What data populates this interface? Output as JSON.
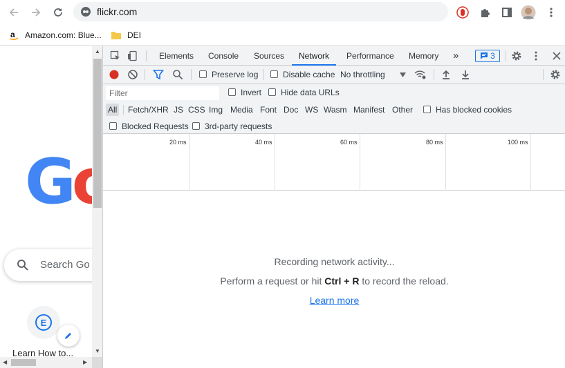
{
  "browser": {
    "url": "flickr.com",
    "bookmarks": [
      {
        "label": "Amazon.com: Blue..."
      },
      {
        "label": "DEI"
      }
    ]
  },
  "page": {
    "logo_text_g": "G",
    "logo_text_o": "o",
    "search_placeholder": "Search Go",
    "shortcut_letter": "E",
    "shortcut_label": "Learn How to..."
  },
  "devtools": {
    "tabs": [
      "Elements",
      "Console",
      "Sources",
      "Network",
      "Performance",
      "Memory"
    ],
    "active_tab": "Network",
    "more_tabs": "»",
    "issues_count": "3",
    "toolbar": {
      "preserve_log": "Preserve log",
      "disable_cache": "Disable cache",
      "throttling": "No throttling"
    },
    "filter": {
      "placeholder": "Filter",
      "invert": "Invert",
      "hide_data_urls": "Hide data URLs",
      "types": [
        "All",
        "Fetch/XHR",
        "JS",
        "CSS",
        "Img",
        "Media",
        "Font",
        "Doc",
        "WS",
        "Wasm",
        "Manifest",
        "Other"
      ],
      "selected_type": "All",
      "has_blocked_cookies": "Has blocked cookies",
      "blocked_requests": "Blocked Requests",
      "third_party": "3rd-party requests"
    },
    "timeline_ticks": [
      "20 ms",
      "40 ms",
      "60 ms",
      "80 ms",
      "100 ms"
    ],
    "empty_state": {
      "recording": "Recording network activity...",
      "perform_prefix": "Perform a request or hit ",
      "shortcut": "Ctrl + R",
      "perform_suffix": " to record the reload.",
      "learn_more": "Learn more"
    },
    "colors": {
      "accent": "#1a73e8",
      "record": "#d93025",
      "toolbar_bg": "#f1f3f4"
    }
  }
}
